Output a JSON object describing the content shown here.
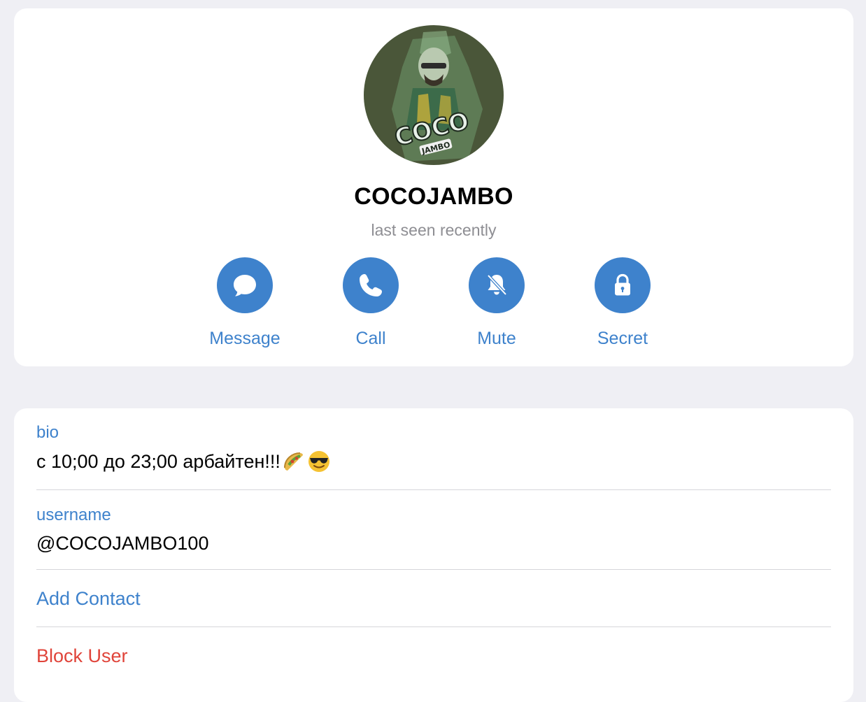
{
  "profile": {
    "name": "COCOJAMBO",
    "status": "last seen recently",
    "avatar_icon": "coco-jambo-avatar-image",
    "avatar_text": "COCO JAMBO"
  },
  "actions": [
    {
      "label": "Message",
      "icon": "chat-bubble-icon"
    },
    {
      "label": "Call",
      "icon": "phone-icon"
    },
    {
      "label": "Mute",
      "icon": "bell-slash-icon"
    },
    {
      "label": "Secret",
      "icon": "lock-icon"
    }
  ],
  "info": {
    "bio_label": "bio",
    "bio_value": "с 10;00 до 23;00 арбайтен!!!",
    "bio_emojis": [
      "taco-emoji",
      "sunglasses-emoji"
    ],
    "username_label": "username",
    "username_value": "@COCOJAMBO100",
    "add_contact": "Add Contact",
    "block_user": "Block User"
  },
  "colors": {
    "accent": "#3e82cc",
    "danger": "#e0443a",
    "background": "#efeff4",
    "secondary_text": "#8e8e93"
  }
}
